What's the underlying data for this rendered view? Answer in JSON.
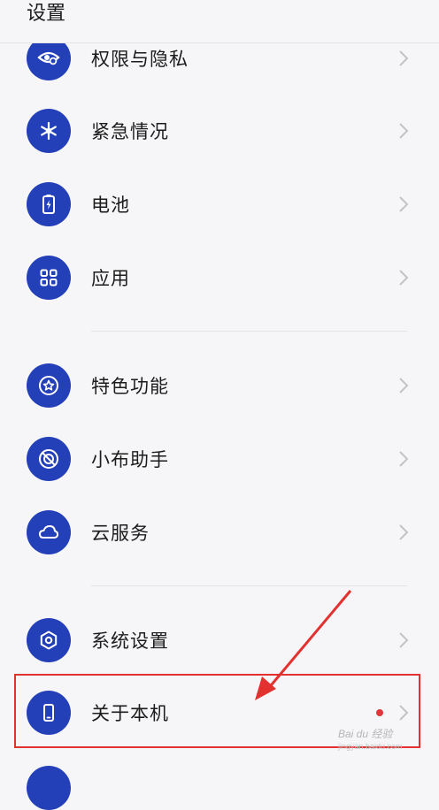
{
  "header": {
    "title": "设置"
  },
  "items": [
    {
      "label": "权限与隐私",
      "icon": "privacy-eye-icon"
    },
    {
      "label": "紧急情况",
      "icon": "snowflake-icon"
    },
    {
      "label": "电池",
      "icon": "battery-icon"
    },
    {
      "label": "应用",
      "icon": "apps-grid-icon"
    },
    {
      "label": "特色功能",
      "icon": "star-icon"
    },
    {
      "label": "小布助手",
      "icon": "assistant-icon"
    },
    {
      "label": "云服务",
      "icon": "cloud-icon"
    },
    {
      "label": "系统设置",
      "icon": "hexagon-gear-icon"
    },
    {
      "label": "关于本机",
      "icon": "phone-icon"
    }
  ],
  "watermark": {
    "text": "Bai du 经验",
    "sub": "jingyan.baidu.com"
  },
  "colors": {
    "icon_bg": "#2440b8",
    "highlight": "#e2312f",
    "dot": "#e0383a"
  }
}
